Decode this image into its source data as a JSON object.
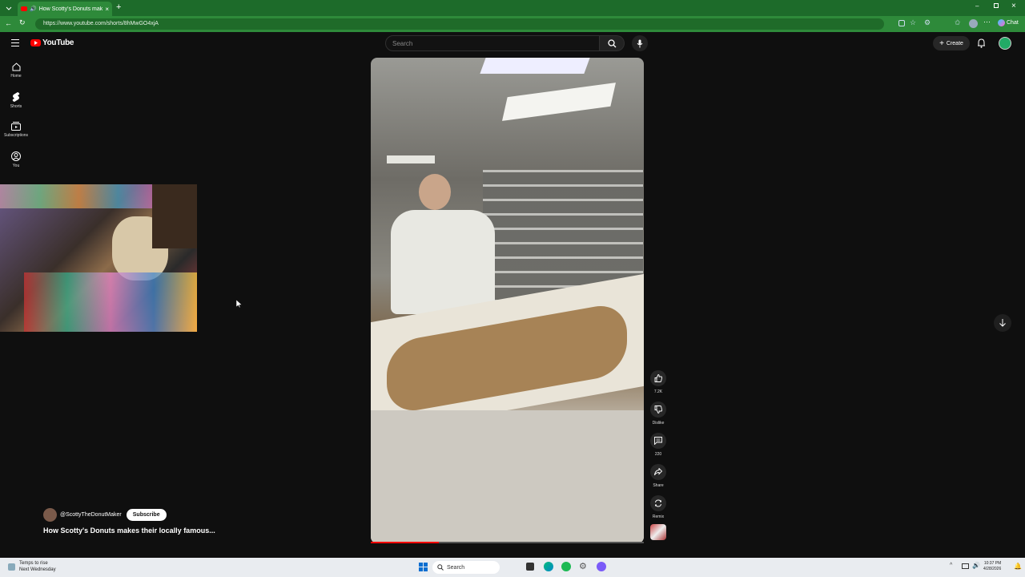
{
  "browser": {
    "tab_title": "How Scotty's Donuts makes th",
    "url": "https://www.youtube.com/shorts/8hMwGO4xjA",
    "chat_label": "Chat"
  },
  "youtube": {
    "logo": "YouTube",
    "search_placeholder": "Search",
    "create_label": "Create",
    "sidebar": [
      {
        "label": "Home",
        "icon": "home-icon"
      },
      {
        "label": "Shorts",
        "icon": "shorts-icon"
      },
      {
        "label": "Subscriptions",
        "icon": "subscriptions-icon"
      },
      {
        "label": "You",
        "icon": "you-icon"
      }
    ]
  },
  "short": {
    "channel": "@ScottyTheDonutMaker",
    "subscribe": "Subscribe",
    "title": "How Scotty's Donuts makes their locally famous...",
    "likes": "7.2K",
    "dislike": "Dislike",
    "comments": "220",
    "share": "Share",
    "remix": "Remix",
    "progress": 0.25
  },
  "taskbar": {
    "weather_line1": "Temps to rise",
    "weather_line2": "Next Wednesday",
    "search": "Search",
    "time": "10:37 PM",
    "date": "4/28/2026"
  },
  "colors": {
    "tabbar": "#1d6b2a",
    "yt_red": "#ff0000",
    "background": "#0f0f0f"
  }
}
